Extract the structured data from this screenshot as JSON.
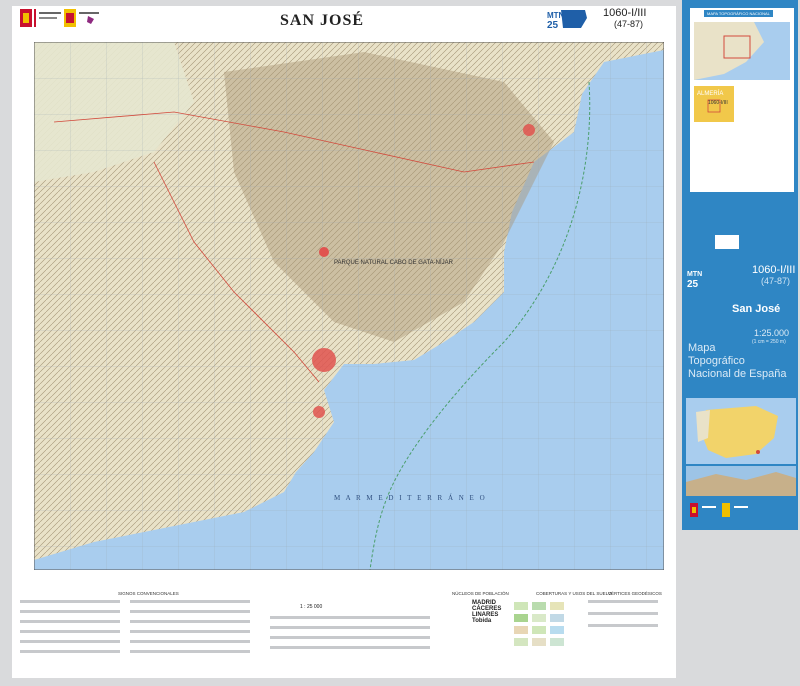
{
  "header": {
    "title": "SAN JOSÉ",
    "sheet_number": "1060-I/III",
    "sheet_alt": "(47-87)",
    "mtn_label": "MTN",
    "mtn_number": "25"
  },
  "map": {
    "park_label": "PARQUE NATURAL CABO DE GATA-NÍJAR",
    "sea_label": "M A R     M E D I T E R R Á N E O",
    "colors": {
      "sea": "#a9cdee",
      "land": "#e9e2c8",
      "relief": "#b3a488",
      "urban": "#e0534f",
      "grid": "#9aa7b3"
    }
  },
  "legend": {
    "signos": "SIGNOS CONVENCIONALES",
    "nucleos": "NÚCLEOS DE POBLACIÓN",
    "cubiertas": "COBERTURAS Y USOS DEL SUELO",
    "vertices": "VÉRTICES GEODÉSICOS",
    "scale": "1 : 25 000",
    "towns": [
      "MADRID",
      "CÁCERES",
      "LINARES",
      "Tobida"
    ]
  },
  "sidebar": {
    "box_title": "MAPA TOPOGRÁFICO NACIONAL",
    "sheet_number": "1060-I/III",
    "sheet_alt": "(47-87)",
    "mtn_label": "MTN",
    "mtn_number": "25",
    "name": "San José",
    "scale": "1:25.000",
    "scale_note": "(1 cm = 250 m)",
    "series": [
      "Mapa",
      "Topográfico",
      "Nacional de España"
    ],
    "inset_region": "ALMERÍA",
    "inset_sheet": "1060-I/III",
    "colors": {
      "panel": "#2f86c4",
      "text": "#ffffff"
    }
  }
}
